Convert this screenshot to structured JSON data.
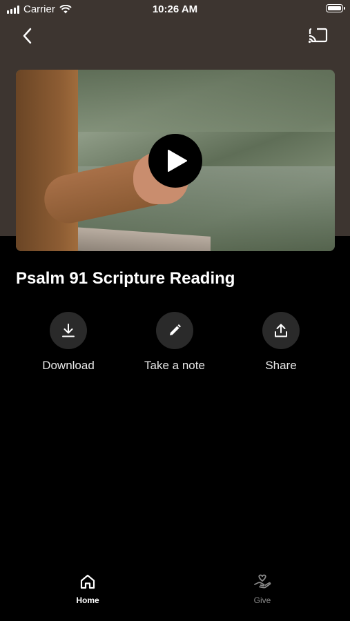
{
  "status_bar": {
    "carrier": "Carrier",
    "time": "10:26 AM"
  },
  "header": {
    "back_icon": "chevron-left-icon",
    "cast_icon": "cast-icon"
  },
  "video": {
    "play_icon": "play-icon"
  },
  "content": {
    "title": "Psalm 91 Scripture Reading"
  },
  "actions": [
    {
      "label": "Download",
      "icon": "download-icon"
    },
    {
      "label": "Take a note",
      "icon": "pencil-icon"
    },
    {
      "label": "Share",
      "icon": "share-icon"
    }
  ],
  "tab_bar": {
    "items": [
      {
        "label": "Home",
        "icon": "home-icon",
        "active": true,
        "color": "#ffffff"
      },
      {
        "label": "Give",
        "icon": "hand-heart-icon",
        "active": false,
        "color": "#8a8a8a"
      }
    ]
  },
  "colors": {
    "header_bg": "#3d3530",
    "background": "#000000",
    "action_circle": "#2a2a2a"
  }
}
